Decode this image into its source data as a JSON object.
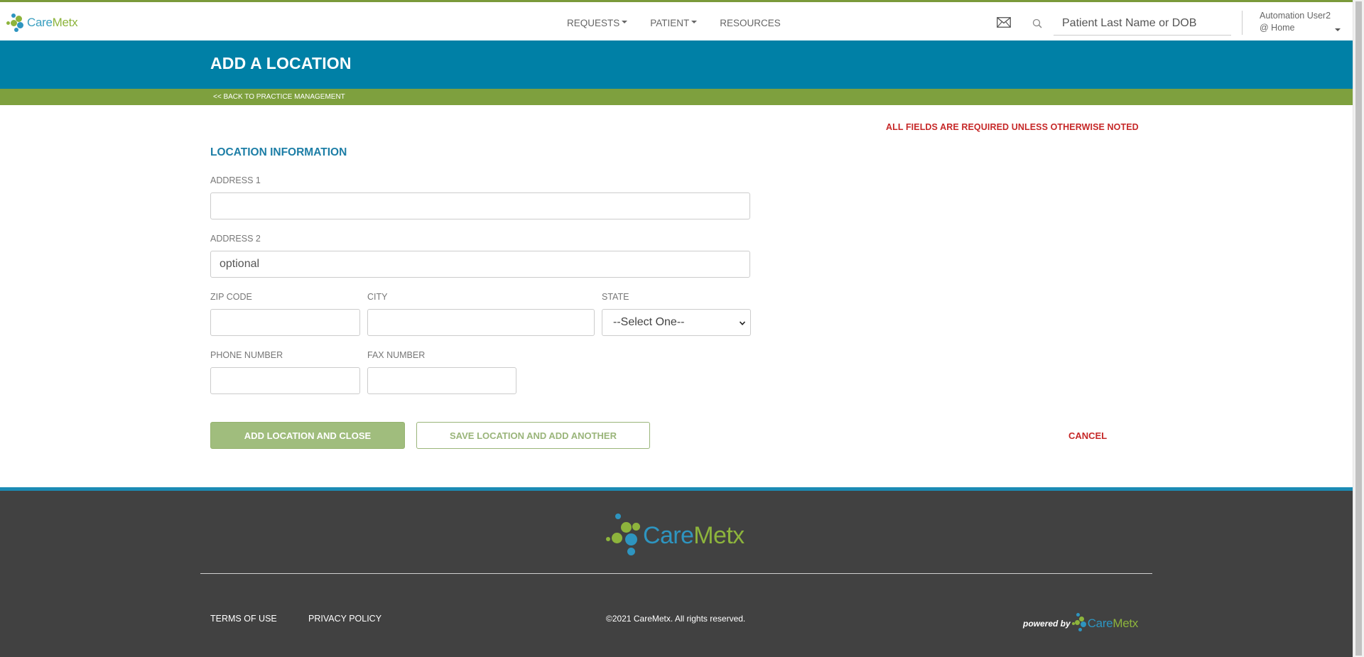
{
  "brand": {
    "name_part1": "Care",
    "name_part2": "Metx",
    "colors": {
      "blue": "#2e95c0",
      "green": "#8db43c",
      "band": "#0080a6",
      "greenbar": "#7ea03e",
      "footer": "#414141",
      "error_red": "#c62828"
    }
  },
  "nav": {
    "items": [
      {
        "label": "REQUESTS",
        "has_dropdown": true
      },
      {
        "label": "PATIENT",
        "has_dropdown": true
      },
      {
        "label": "RESOURCES",
        "has_dropdown": false
      }
    ],
    "icons": {
      "mail": "mail-icon",
      "search": "search-icon"
    },
    "search_placeholder": "Patient Last Name or DOB",
    "user": {
      "name": "Automation User2",
      "location": "@ Home"
    }
  },
  "header": {
    "title": "ADD A LOCATION",
    "back_link": "<< BACK TO PRACTICE MANAGEMENT"
  },
  "form": {
    "required_note": "ALL FIELDS ARE REQUIRED UNLESS OTHERWISE NOTED",
    "section_title": "LOCATION INFORMATION",
    "fields": {
      "address1": {
        "label": "ADDRESS 1",
        "value": "",
        "placeholder": ""
      },
      "address2": {
        "label": "ADDRESS 2",
        "value": "",
        "placeholder": "optional"
      },
      "zip": {
        "label": "ZIP CODE",
        "value": "",
        "placeholder": ""
      },
      "city": {
        "label": "CITY",
        "value": "",
        "placeholder": ""
      },
      "state": {
        "label": "STATE",
        "selected": "--Select One--"
      },
      "phone": {
        "label": "PHONE NUMBER",
        "value": "",
        "placeholder": ""
      },
      "fax": {
        "label": "FAX NUMBER",
        "value": "",
        "placeholder": ""
      }
    },
    "buttons": {
      "add_close": "ADD LOCATION AND CLOSE",
      "save_another": "SAVE LOCATION AND ADD ANOTHER",
      "cancel": "CANCEL"
    }
  },
  "footer": {
    "terms": "TERMS OF USE",
    "privacy": "PRIVACY POLICY",
    "copyright": "©2021 CareMetx. All rights reserved.",
    "powered_by": "powered by"
  }
}
